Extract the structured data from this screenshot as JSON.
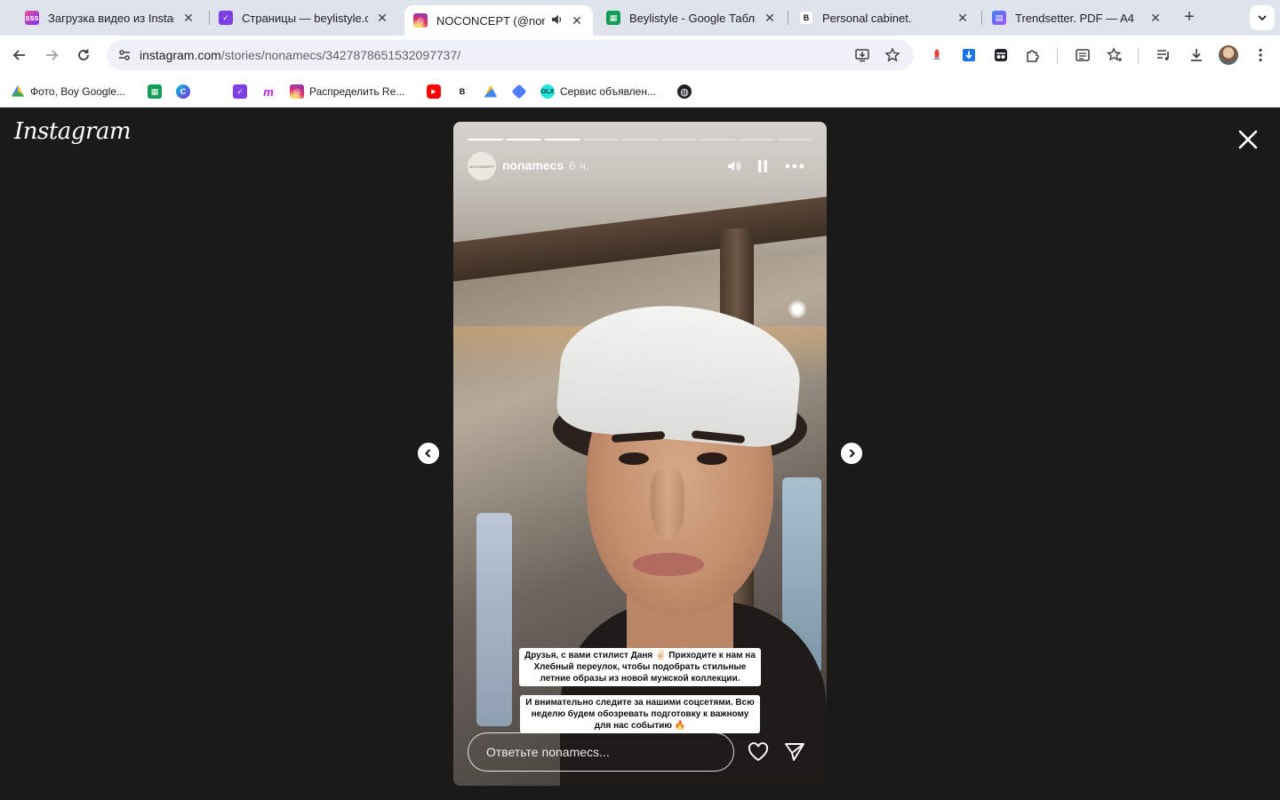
{
  "browser": {
    "tabs": [
      {
        "title": "Загрузка видео из Instag",
        "favicon": "sss-icon",
        "active": false
      },
      {
        "title": "Страницы — beylistyle.co",
        "favicon": "tilda-icon",
        "active": false
      },
      {
        "title": "NOCONCEPT (@nonar",
        "favicon": "instagram-icon",
        "active": true,
        "audio": true
      },
      {
        "title": "Beylistyle - Google Табли",
        "favicon": "google-sheets-icon",
        "active": false
      },
      {
        "title": "Personal cabinet.",
        "favicon": "b-icon",
        "active": false
      },
      {
        "title": "Trendsetter. PDF — A4",
        "favicon": "trendsetter-icon",
        "active": false
      }
    ],
    "url_host": "instagram.com",
    "url_path": "/stories/nonamecs/3427878651532097737/",
    "bookmarks": [
      {
        "label": "Фото, Boy Google...",
        "icon": "google-drive-icon"
      },
      {
        "label": "",
        "icon": "google-sheets-icon"
      },
      {
        "label": "",
        "icon": "canva-icon"
      },
      {
        "label": "",
        "icon": "apple-icon"
      },
      {
        "label": "",
        "icon": "tilda-icon"
      },
      {
        "label": "",
        "icon": "miro-icon"
      },
      {
        "label": "Распределить Re...",
        "icon": "instagram-icon"
      },
      {
        "label": "",
        "icon": "youtube-icon"
      },
      {
        "label": "",
        "icon": "b-icon"
      },
      {
        "label": "",
        "icon": "google-ads-icon"
      },
      {
        "label": "",
        "icon": "dropbox-icon"
      },
      {
        "label": "Сервис объявлен...",
        "icon": "olx-icon"
      },
      {
        "label": "",
        "icon": "globe-icon"
      }
    ]
  },
  "instagram": {
    "logo_text": "Instagram",
    "story": {
      "username": "nonamecs",
      "time_ago": "6 ч.",
      "avatar_text": "NOCONCEPT",
      "segments_total": 9,
      "segments_done": 3,
      "caption_lines": [
        "Друзья, с вами стилист Даня ✌🏻 Приходите к нам на",
        "Хлебный переулок, чтобы подобрать стильные",
        "летние образы из новой мужской коллекции."
      ],
      "caption2_lines": [
        "И внимательно следите за нашими соцсетями. Всю",
        "неделю будем обозревать подготовку к важному",
        "для нас событию 🔥"
      ],
      "reply_placeholder": "Ответьте nonamecs..."
    }
  },
  "colors": {
    "viewer_bg": "#1a1a1a",
    "tabstrip_bg": "#dfe3eb",
    "instagram_accent": "#e1306c"
  }
}
